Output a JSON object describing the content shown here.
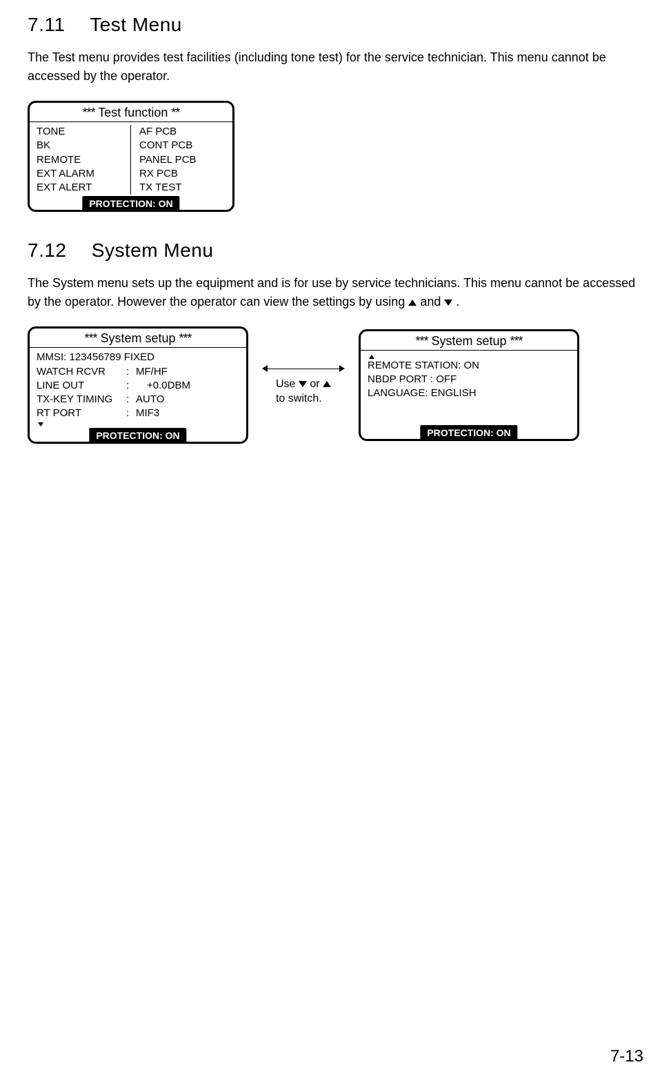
{
  "sections": {
    "test_menu": {
      "number": "7.11",
      "title": "Test Menu",
      "body": "The Test menu provides test facilities (including tone test) for the service technician. This menu cannot be accessed by the operator."
    },
    "system_menu": {
      "number": "7.12",
      "title": "System Menu",
      "body_part1": "The System menu sets up the equipment and is for use by service technicians. This menu cannot be accessed by the operator. However the operator can view the settings by using ",
      "body_part2": " and ",
      "body_part3": " ."
    }
  },
  "test_panel": {
    "title_prefix": "***",
    "title_text": "Test function",
    "title_suffix": "**",
    "col1": [
      "TONE",
      "BK",
      "REMOTE",
      "EXT ALARM",
      "EXT ALERT"
    ],
    "col2": [
      "AF PCB",
      "CONT PCB",
      "PANEL PCB",
      "RX PCB",
      "TX TEST"
    ],
    "protection": "PROTECTION: ON"
  },
  "system_panel1": {
    "title_prefix": "***",
    "title_text": "System setup",
    "title_suffix": "***",
    "mmsi_line": "MMSI: 123456789 FIXED",
    "rows": [
      {
        "key": "WATCH RCVR",
        "val": "MF/HF"
      },
      {
        "key": "LINE OUT",
        "val": "+0.0DBM"
      },
      {
        "key": "TX-KEY TIMING",
        "val": "AUTO"
      },
      {
        "key": "RT PORT",
        "val": "MIF3"
      }
    ],
    "protection": "PROTECTION: ON"
  },
  "system_panel2": {
    "title_prefix": "***",
    "title_text": "System setup",
    "title_suffix": "***",
    "lines": [
      "REMOTE STATION: ON",
      "NBDP PORT          : OFF",
      "LANGUAGE: ENGLISH"
    ],
    "protection": "PROTECTION: ON"
  },
  "switch_hint": {
    "line1_prefix": "Use  ",
    "line1_mid": " or ",
    "line2": "to switch."
  },
  "page_number": "7-13"
}
